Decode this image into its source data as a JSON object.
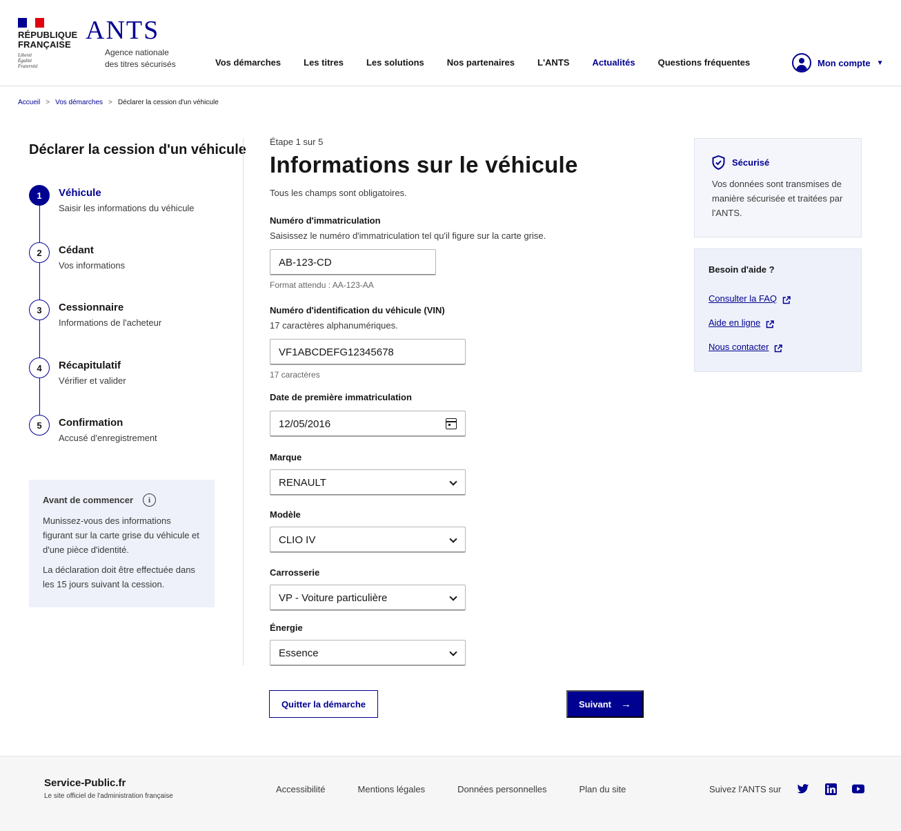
{
  "header": {
    "republic_name_line1": "RÉPUBLIQUE",
    "republic_name_line2": "FRANÇAISE",
    "motto_line1": "Liberté",
    "motto_line2": "Égalité",
    "motto_line3": "Fraternité",
    "brand": "ANTS",
    "brand_sub_line1": "Agence nationale",
    "brand_sub_line2": "des titres sécurisés",
    "nav": [
      {
        "label": "Vos démarches"
      },
      {
        "label": "Les titres"
      },
      {
        "label": "Les solutions"
      },
      {
        "label": "Nos partenaires"
      },
      {
        "label": "L'ANTS"
      },
      {
        "label": "Actualités"
      },
      {
        "label": "Questions fréquentes"
      }
    ],
    "account_label": "Mon compte",
    "flag_colors": [
      "#000091",
      "#ffffff",
      "#e1000f"
    ],
    "accent_color": "#000091"
  },
  "breadcrumb": {
    "items": [
      "Accueil",
      "Vos démarches"
    ],
    "current": "Déclarer la cession d'un véhicule"
  },
  "sidebar": {
    "title": "Déclarer la cession d'un véhicule",
    "steps": [
      {
        "number": "1",
        "title": "Véhicule",
        "desc": "Saisir les informations du véhicule",
        "state": "active"
      },
      {
        "number": "2",
        "title": "Cédant",
        "desc": "Vos informations",
        "state": "pending"
      },
      {
        "number": "3",
        "title": "Cessionnaire",
        "desc": "Informations de l'acheteur",
        "state": "pending"
      },
      {
        "number": "4",
        "title": "Récapitulatif",
        "desc": "Vérifier et valider",
        "state": "pending"
      },
      {
        "number": "5",
        "title": "Confirmation",
        "desc": "Accusé d'enregistrement",
        "state": "pending"
      }
    ],
    "info_box": {
      "title": "Avant de commencer",
      "icon": "info-icon",
      "p1": "Munissez-vous des informations figurant sur la carte grise du véhicule et d'une pièce d'identité.",
      "p2": "La déclaration doit être effectuée dans les 15 jours suivant la cession."
    }
  },
  "main": {
    "step_label": "Étape 1 sur 5",
    "title": "Informations sur le véhicule",
    "required_note": "Tous les champs sont obligatoires.",
    "fields": {
      "immat": {
        "label": "Numéro d'immatriculation",
        "hint": "Saisissez le numéro d'immatriculation tel qu'il figure sur la carte grise.",
        "value": "AB-123-CD",
        "help": "Format attendu : AA-123-AA"
      },
      "vin": {
        "label": "Numéro d'identification du véhicule (VIN)",
        "hint": "17 caractères alphanumériques.",
        "value": "VF1ABCDEFG12345678",
        "help": "17 caractères"
      },
      "date": {
        "label": "Date de première immatriculation",
        "value": "12/05/2016"
      },
      "marque": {
        "label": "Marque",
        "value": "RENAULT"
      },
      "modele": {
        "label": "Modèle",
        "value": "CLIO IV"
      },
      "carrosserie": {
        "label": "Carrosserie",
        "value": "VP - Voiture particulière"
      },
      "energie": {
        "label": "Énergie",
        "value": "Essence"
      }
    },
    "quit_label": "Quitter la démarche",
    "next_label": "Suivant"
  },
  "aside": {
    "secure_title": "Sécurisé",
    "secure_text": "Vos données sont transmises de manière sécurisée et traitées par l'ANTS.",
    "help_title": "Besoin d'aide ?",
    "help_links": [
      {
        "label": "Consulter la FAQ"
      },
      {
        "label": "Aide en ligne"
      },
      {
        "label": "Nous contacter"
      }
    ]
  },
  "footer": {
    "brand_name": "Service-Public.fr",
    "brand_sub": "Le site officiel de l'administration française",
    "links": [
      {
        "label": "Accessibilité"
      },
      {
        "label": "Mentions légales"
      },
      {
        "label": "Données personnelles"
      },
      {
        "label": "Plan du site"
      }
    ],
    "social_label": "Suivez l'ANTS sur",
    "social": [
      "twitter-icon",
      "linkedin-icon",
      "youtube-icon"
    ]
  }
}
